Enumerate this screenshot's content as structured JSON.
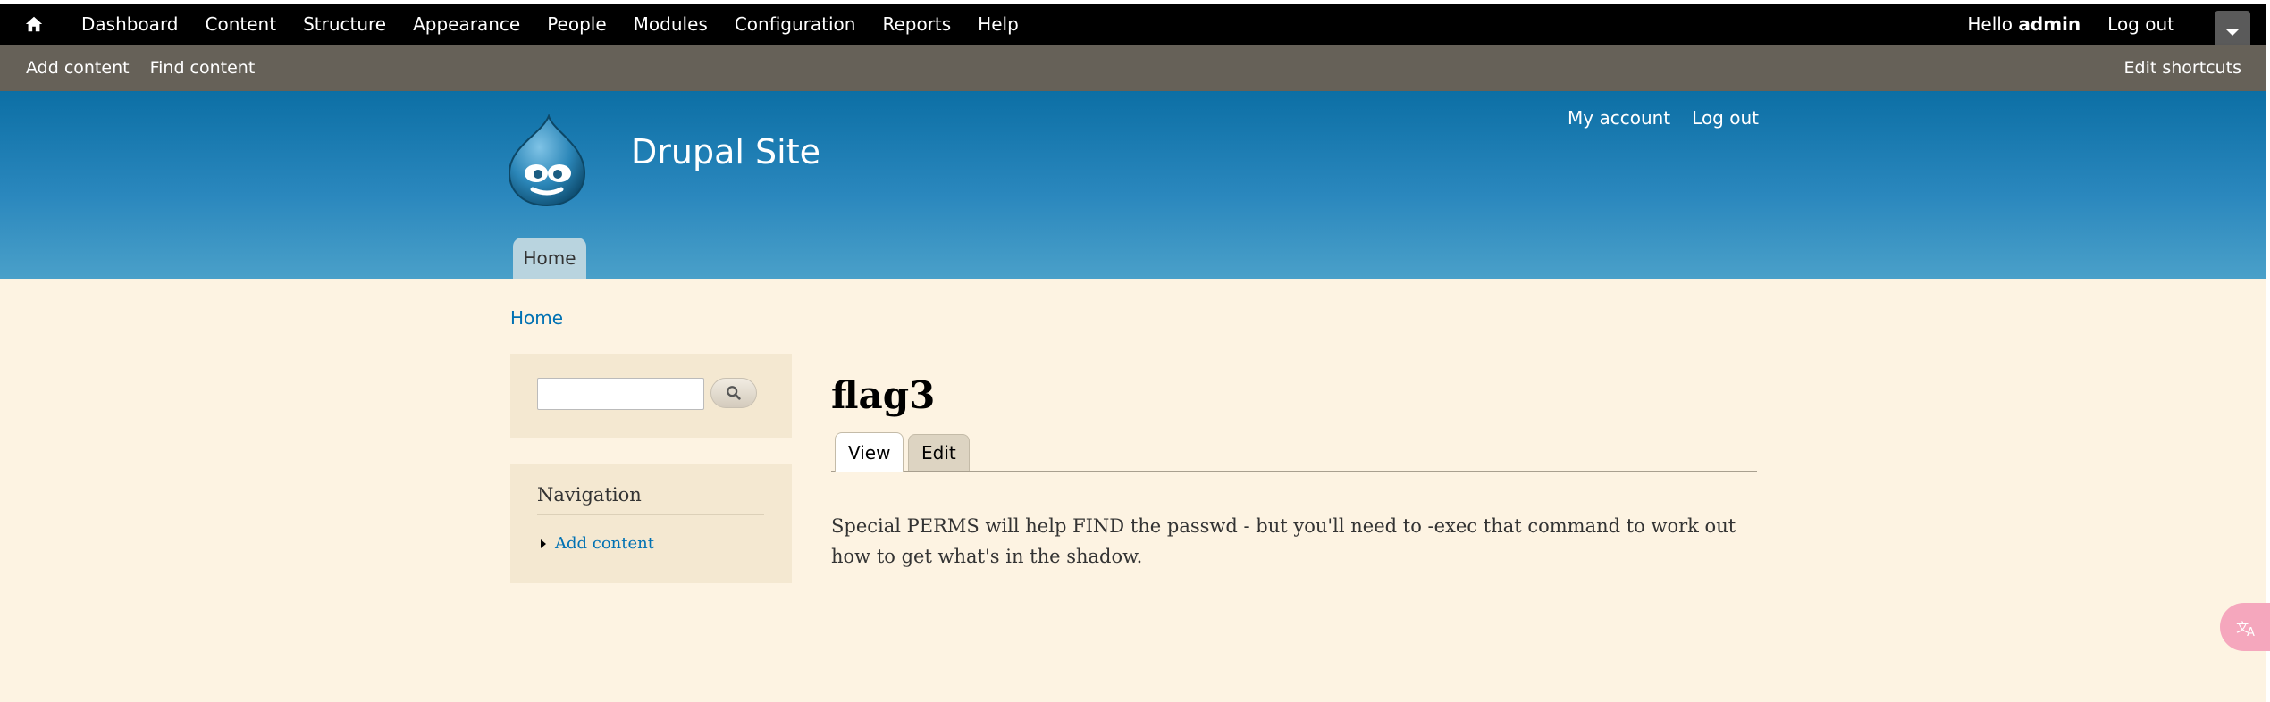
{
  "toolbar": {
    "items": [
      "Dashboard",
      "Content",
      "Structure",
      "Appearance",
      "People",
      "Modules",
      "Configuration",
      "Reports",
      "Help"
    ],
    "hello_prefix": "Hello",
    "user": "admin",
    "logout": "Log out"
  },
  "shortcuts": {
    "add_content": "Add content",
    "find_content": "Find content",
    "edit_shortcuts": "Edit shortcuts"
  },
  "header": {
    "site_name": "Drupal Site",
    "secondary_menu": [
      "My account",
      "Log out"
    ],
    "main_tab": "Home"
  },
  "breadcrumb": "Home",
  "search": {
    "value": ""
  },
  "navigation": {
    "title": "Navigation",
    "items": [
      "Add content"
    ]
  },
  "page": {
    "title": "flag3",
    "tabs": [
      "View",
      "Edit"
    ],
    "body": "Special PERMS will help FIND the passwd - but you'll need to -exec that command to work out how to get what's in the shadow."
  },
  "colors": {
    "toolbar": "#000000",
    "shortcuts": "#666158",
    "header": "#2a87bd",
    "link": "#0071b3",
    "background": "#fdf3e2"
  }
}
